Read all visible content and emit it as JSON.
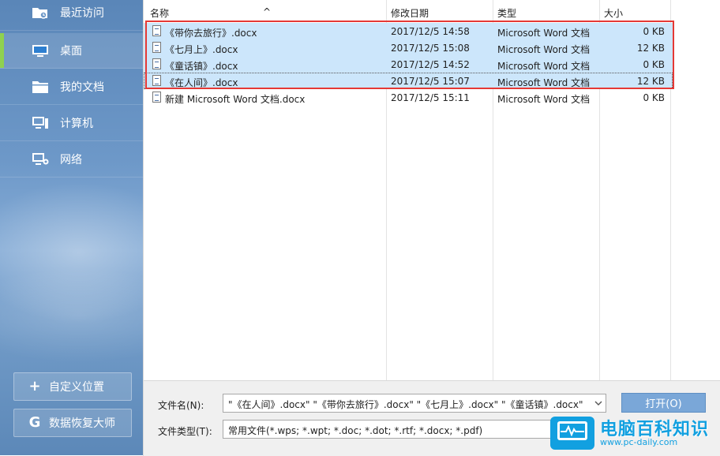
{
  "sidebar": {
    "items": [
      {
        "label": "最近访问",
        "icon": "recent-folder-icon",
        "active": false
      },
      {
        "label": "桌面",
        "icon": "desktop-icon",
        "active": true
      },
      {
        "label": "我的文档",
        "icon": "documents-folder-icon",
        "active": false
      },
      {
        "label": "计算机",
        "icon": "computer-icon",
        "active": false
      },
      {
        "label": "网络",
        "icon": "network-icon",
        "active": false
      }
    ],
    "custom_location_label": "自定义位置",
    "custom_location_symbol": "+",
    "recovery_label": "数据恢复大师",
    "recovery_symbol": "G",
    "accent_color": "#8fd14f"
  },
  "file_list": {
    "columns": {
      "name": "名称",
      "modified": "修改日期",
      "type": "类型",
      "size": "大小"
    },
    "sort_indicator": "^",
    "rows": [
      {
        "name": "《带你去旅行》.docx",
        "modified": "2017/12/5 14:58",
        "type": "Microsoft Word 文档",
        "size": "0 KB",
        "selected": true
      },
      {
        "name": "《七月上》.docx",
        "modified": "2017/12/5 15:08",
        "type": "Microsoft Word 文档",
        "size": "12 KB",
        "selected": true
      },
      {
        "name": "《童话镇》.docx",
        "modified": "2017/12/5 14:52",
        "type": "Microsoft Word 文档",
        "size": "0 KB",
        "selected": true
      },
      {
        "name": "《在人间》.docx",
        "modified": "2017/12/5 15:07",
        "type": "Microsoft Word 文档",
        "size": "12 KB",
        "selected": true
      },
      {
        "name": "新建 Microsoft Word 文档.docx",
        "modified": "2017/12/5 15:11",
        "type": "Microsoft Word 文档",
        "size": "0 KB",
        "selected": false
      }
    ],
    "selection_color": "#cce6fb",
    "highlight_color": "#e53935"
  },
  "bottom": {
    "filename_label": "文件名(N):",
    "filename_value": "\"《在人间》.docx\" \"《带你去旅行》.docx\" \"《七月上》.docx\" \"《童话镇》.docx\"",
    "filetype_label": "文件类型(T):",
    "filetype_value": "常用文件(*.wps; *.wpt; *.doc; *.dot; *.rtf; *.docx; *.pdf)",
    "open_label": "打开(O)",
    "dropdown_icon": "chevron-down-icon"
  },
  "watermark": {
    "title": "电脑百科知识",
    "url": "www.pc-daily.com"
  }
}
